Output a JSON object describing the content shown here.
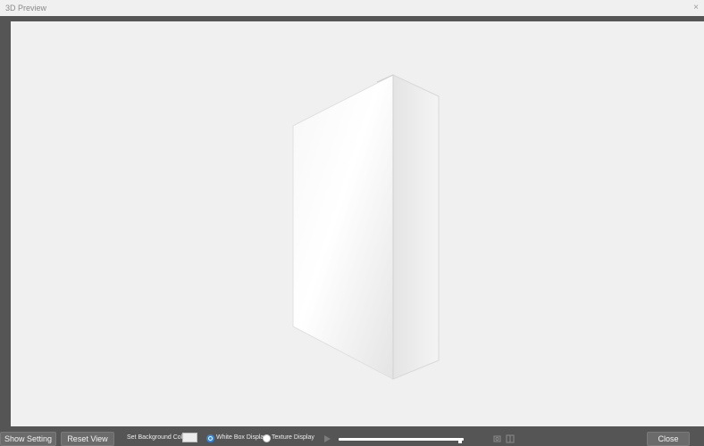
{
  "window": {
    "title": "3D Preview",
    "close_symbol": "×"
  },
  "toolbar": {
    "show_setting_label": "Show Setting",
    "reset_view_label": "Reset View",
    "background_color_label": "Set Background Color:",
    "background_color_value": "#ececec",
    "display_modes": [
      {
        "label": "White Box Display",
        "selected": true
      },
      {
        "label": "Texture Display",
        "selected": false
      }
    ],
    "animation_progress": 0.97,
    "close_label": "Close"
  },
  "viewport": {
    "background": "#f0f0f0",
    "model_description_icon": "white-box-model"
  },
  "icons": {
    "play": "play-icon",
    "camera": "camera-icon",
    "view": "frame-view-icon"
  }
}
